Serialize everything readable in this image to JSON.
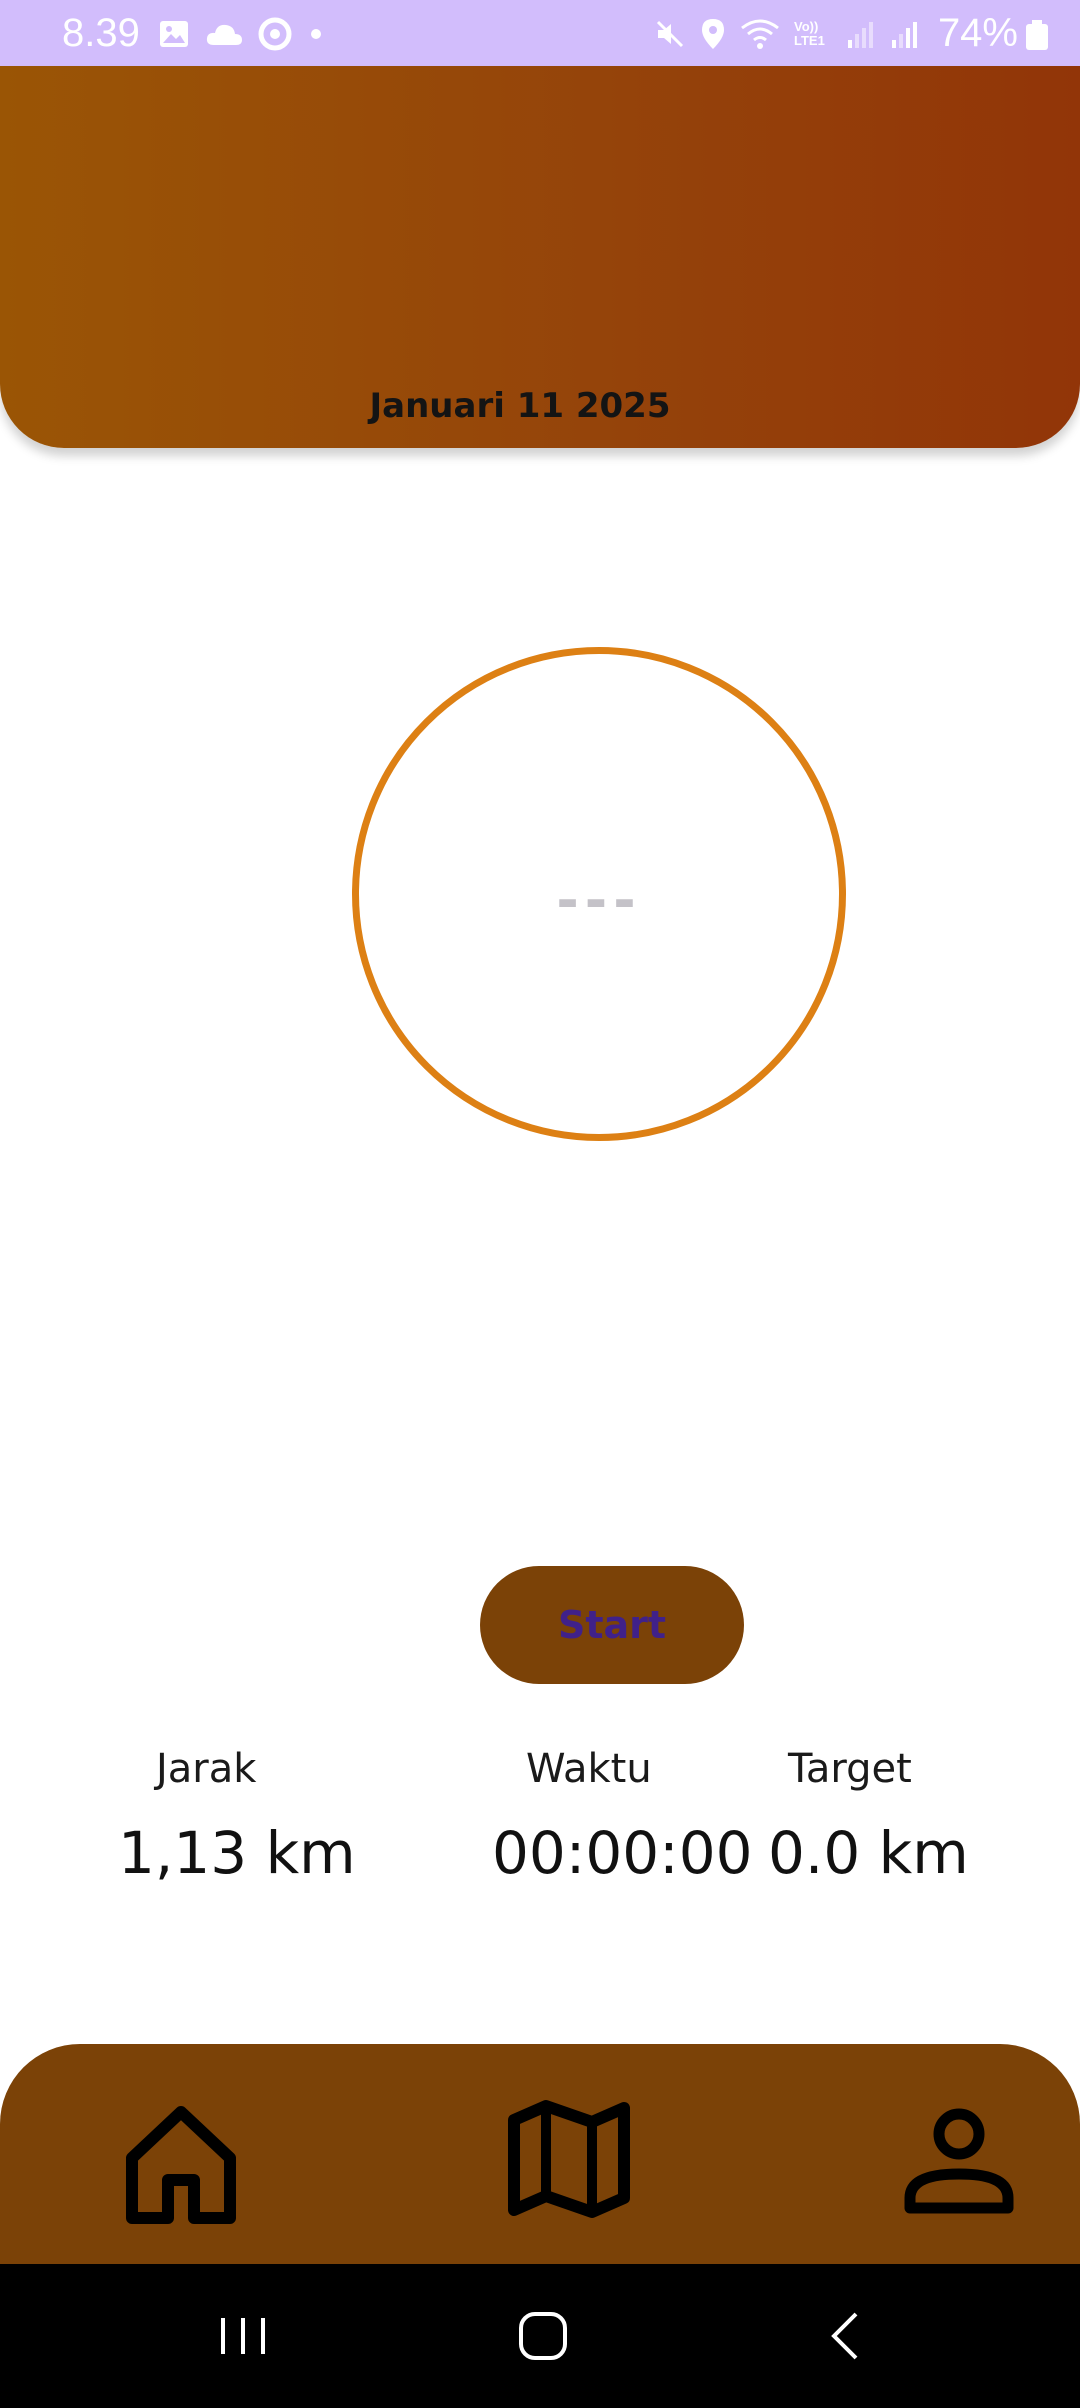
{
  "status_bar": {
    "time": "8.39",
    "battery": "74%",
    "network_label": "Vo)) LTE1",
    "background_color": "#d2bdfc",
    "left_icons": [
      "gallery-icon",
      "cloud-icon",
      "circle-app-icon",
      "dot-icon"
    ],
    "right_icons": [
      "mute-icon",
      "location-icon",
      "wifi-icon",
      "signal-icon",
      "signal-icon",
      "battery-icon"
    ]
  },
  "header": {
    "date": "Januari 11 2025"
  },
  "tracker": {
    "circle_value": "---",
    "ring_color": "#dd8014",
    "start_label": "Start"
  },
  "stats": {
    "distance": {
      "label": "Jarak",
      "value": "1,13 km"
    },
    "time": {
      "label": "Waktu",
      "value": "00:00:00"
    },
    "target": {
      "label": "Target",
      "value": "0.0 km"
    }
  },
  "bottom_nav": {
    "background_color": "#7b4207",
    "items": [
      "home-icon",
      "map-icon",
      "profile-icon"
    ]
  },
  "system_nav": {
    "buttons": [
      "recent-apps-icon",
      "home-button-icon",
      "back-icon"
    ]
  }
}
